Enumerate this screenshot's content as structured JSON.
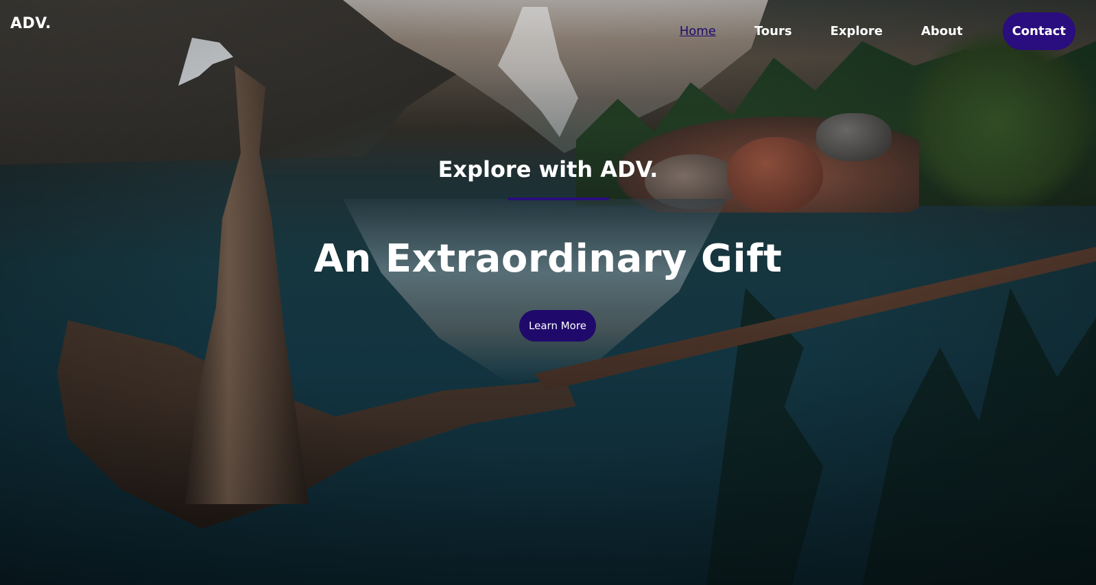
{
  "brand": {
    "logo": "ADV."
  },
  "nav": {
    "items": [
      {
        "label": "Home",
        "active": true
      },
      {
        "label": "Tours"
      },
      {
        "label": "Explore"
      },
      {
        "label": "About"
      }
    ],
    "contact_label": "Contact"
  },
  "hero": {
    "subtitle": "Explore with ADV.",
    "headline": "An Extraordinary Gift",
    "cta_label": "Learn More"
  },
  "colors": {
    "accent": "#2a0d7e",
    "button": "#1f0a6b",
    "text": "#ffffff",
    "active_link": "#1e0b6e"
  }
}
